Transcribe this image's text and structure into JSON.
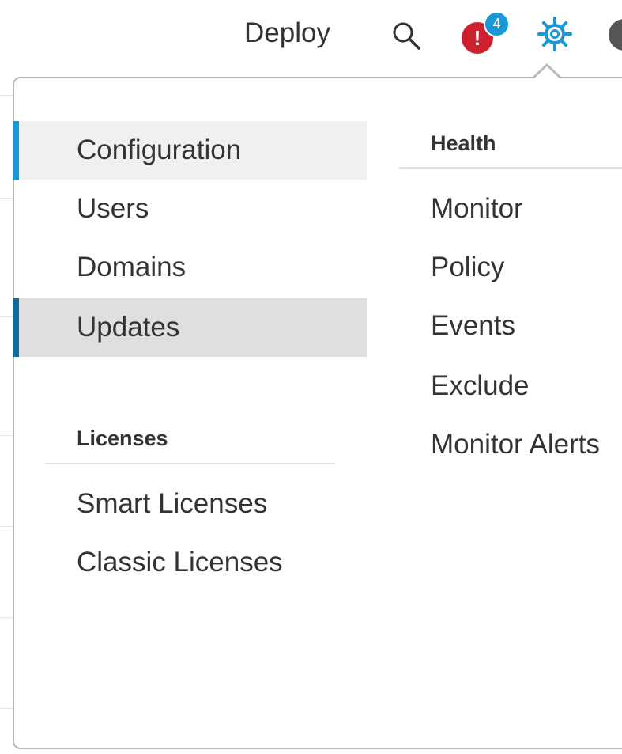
{
  "header": {
    "deploy_label": "Deploy",
    "alert_count": "4",
    "alert_symbol": "!",
    "icons": [
      "search-icon",
      "alert-icon",
      "gear-icon",
      "user-avatar"
    ]
  },
  "settings_menu": {
    "system_items": [
      {
        "label": "Configuration",
        "state": "hover"
      },
      {
        "label": "Users",
        "state": "normal"
      },
      {
        "label": "Domains",
        "state": "normal"
      },
      {
        "label": "Updates",
        "state": "selected"
      }
    ],
    "licenses": {
      "heading": "Licenses",
      "items": [
        "Smart Licenses",
        "Classic Licenses"
      ]
    },
    "health": {
      "heading": "Health",
      "items": [
        "Monitor",
        "Policy",
        "Events",
        "Exclude",
        "Monitor Alerts"
      ]
    }
  },
  "colors": {
    "accent": "#1a98d5",
    "selected_bar": "#0f6c9a",
    "alert": "#cf2030",
    "hover_bg": "#f0f0f0",
    "selected_bg": "#dfdfdf"
  }
}
